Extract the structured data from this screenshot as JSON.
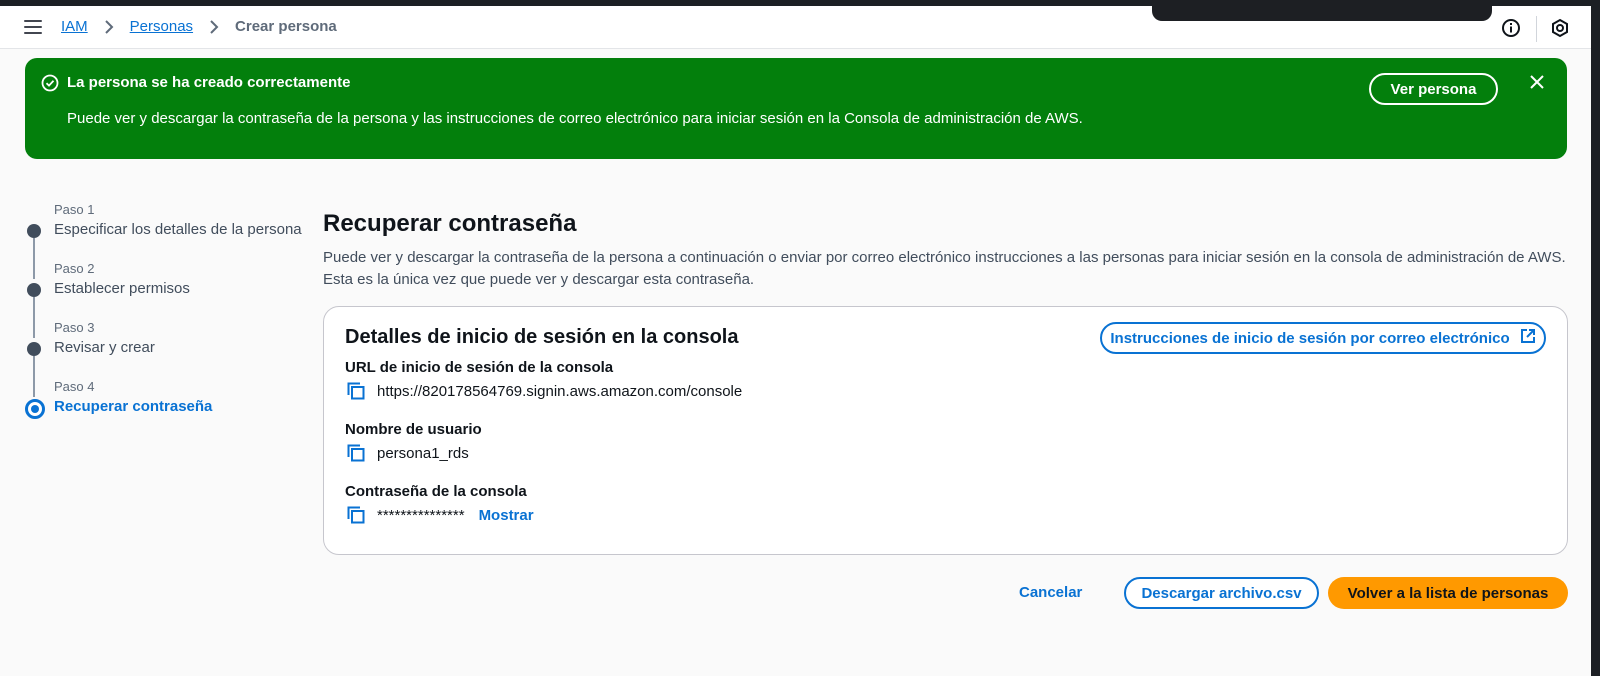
{
  "breadcrumb": {
    "items": [
      "IAM",
      "Personas"
    ],
    "current": "Crear persona"
  },
  "flash": {
    "title": "La persona se ha creado correctamente",
    "message": "Puede ver y descargar la contraseña de la persona y las instrucciones de correo electrónico para iniciar sesión en la Consola de administración de AWS.",
    "action_label": "Ver persona",
    "color": "#037f0c"
  },
  "steps": [
    {
      "label": "Paso 1",
      "title": "Especificar los detalles de la persona"
    },
    {
      "label": "Paso 2",
      "title": "Establecer permisos"
    },
    {
      "label": "Paso 3",
      "title": "Revisar y crear"
    },
    {
      "label": "Paso 4",
      "title": "Recuperar contraseña"
    }
  ],
  "page": {
    "title": "Recuperar contraseña",
    "description_1": "Puede ver y descargar la contraseña de la persona a continuación o enviar por correo electrónico instrucciones a las personas para iniciar sesión en la consola de administración de AWS.",
    "description_2": "Esta es la única vez que puede ver y descargar esta contraseña."
  },
  "card": {
    "title": "Detalles de inicio de sesión en la consola",
    "email_button_label": "Instrucciones de inicio de sesión por correo electrónico",
    "fields": {
      "url": {
        "label": "URL de inicio de sesión de la consola",
        "value": "https://820178564769.signin.aws.amazon.com/console"
      },
      "username": {
        "label": "Nombre de usuario",
        "value": "persona1_rds"
      },
      "password": {
        "label": "Contraseña de la consola",
        "value": "***************",
        "show_label": "Mostrar"
      }
    }
  },
  "actions": {
    "cancel": "Cancelar",
    "download": "Descargar archivo.csv",
    "primary": "Volver a la lista de personas"
  },
  "colors": {
    "accent": "#0972d3",
    "primary_button": "#ff9900",
    "success": "#037f0c"
  }
}
